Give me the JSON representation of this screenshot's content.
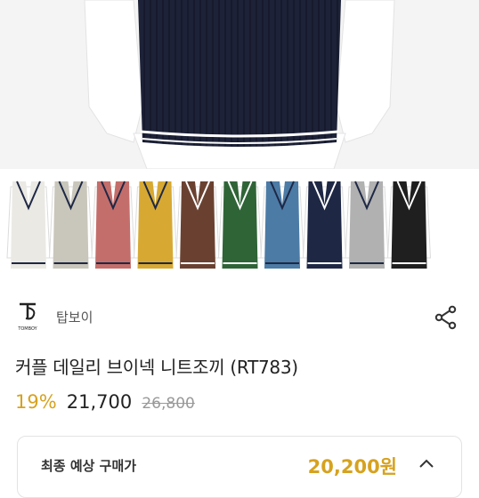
{
  "brand": {
    "logo_text": "TOMBOY",
    "name": "탑보이"
  },
  "icons": {
    "share": "share-icon",
    "chevron": "chevron-up-icon"
  },
  "product": {
    "title": "커플 데일리 브이넥 니트조끼 (RT783)"
  },
  "pricing": {
    "discount": "19%",
    "price": "21,700",
    "original_price": "26,800"
  },
  "final_price": {
    "label": "최종 예상 구매가",
    "value": "20,200원"
  },
  "colors": {
    "accent": "#d6a21f",
    "vest_swatches": [
      "#ebe9e4",
      "#c9c6bb",
      "#c46e6b",
      "#d7a933",
      "#6a4130",
      "#2f6437",
      "#4c7ba6",
      "#1e2845",
      "#b1b1b1",
      "#1f1f1f"
    ]
  }
}
